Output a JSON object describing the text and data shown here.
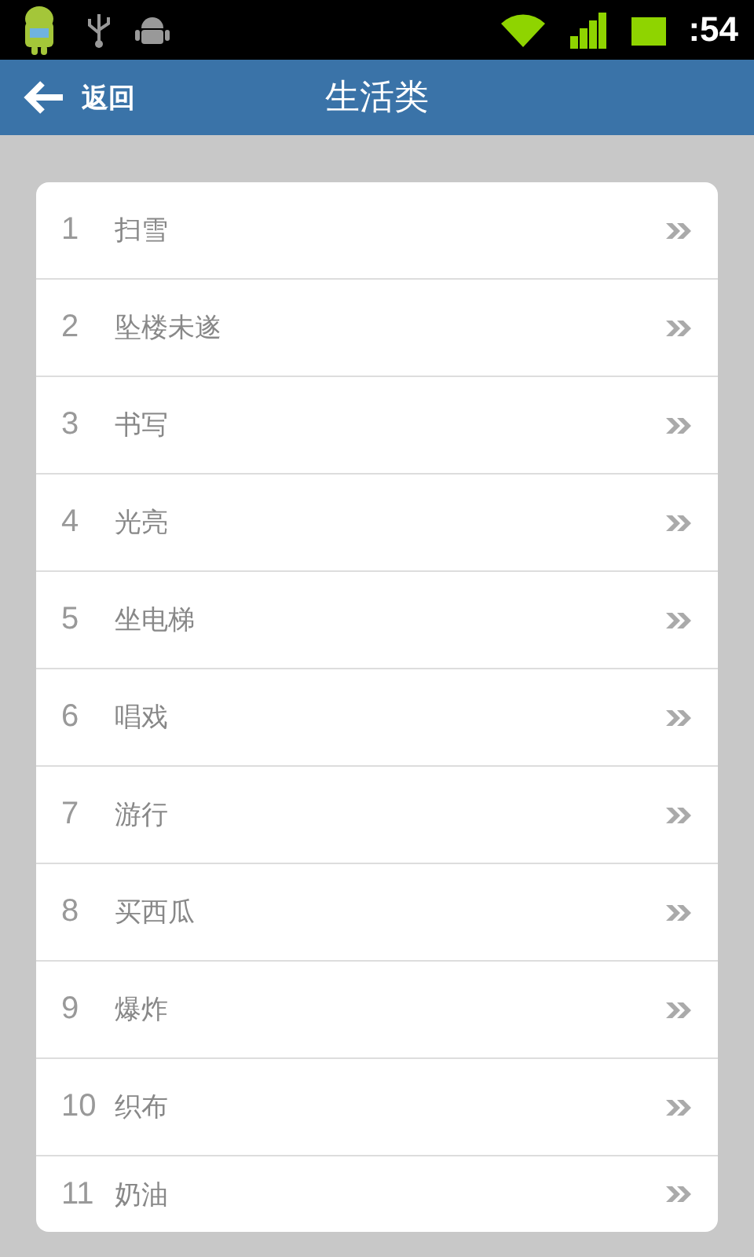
{
  "status_bar": {
    "time": ":54"
  },
  "header": {
    "back": "返回",
    "title": "生活类"
  },
  "items": [
    {
      "number": "1",
      "label": "扫雪"
    },
    {
      "number": "2",
      "label": "坠楼未遂"
    },
    {
      "number": "3",
      "label": "书写"
    },
    {
      "number": "4",
      "label": "光亮"
    },
    {
      "number": "5",
      "label": "坐电梯"
    },
    {
      "number": "6",
      "label": "唱戏"
    },
    {
      "number": "7",
      "label": "游行"
    },
    {
      "number": "8",
      "label": "买西瓜"
    },
    {
      "number": "9",
      "label": "爆炸"
    },
    {
      "number": "10",
      "label": "织布"
    },
    {
      "number": "11",
      "label": "奶油"
    }
  ]
}
